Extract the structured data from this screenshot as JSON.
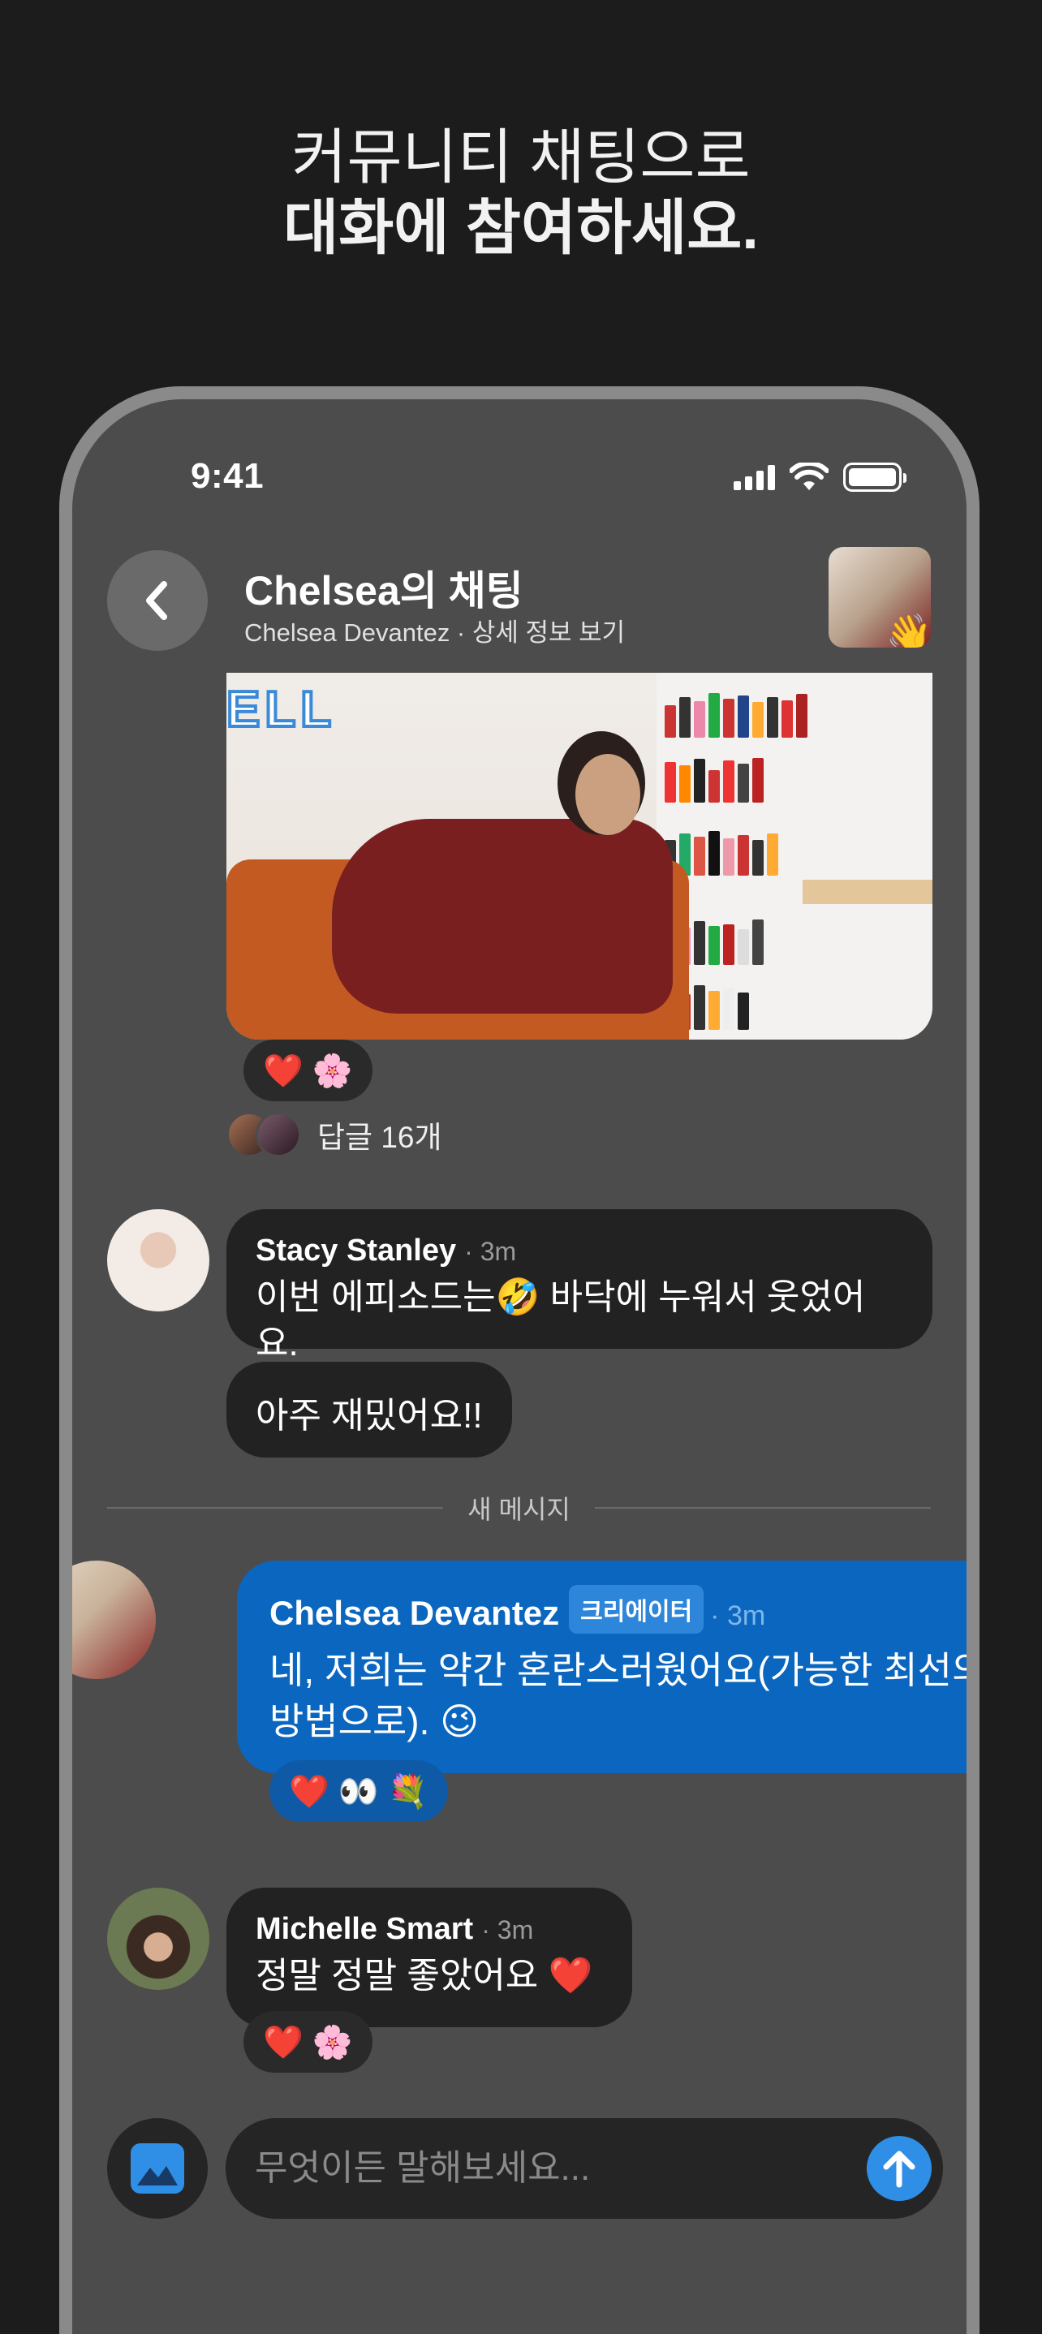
{
  "headline": {
    "line1": "커뮤니티 채팅으로",
    "line2": "대화에 참여하세요."
  },
  "status_bar": {
    "time": "9:41"
  },
  "chat_header": {
    "title": "Chelsea의 채팅",
    "subtitle": "Chelsea Devantez · 상세 정보 보기",
    "thumb_emoji": "👋"
  },
  "post": {
    "logo_text": "ELL",
    "reactions": "❤️ 🌸",
    "replies_label": "답글 16개"
  },
  "messages": [
    {
      "author": "Stacy Stanley",
      "time": "3m",
      "text": "이번 에피소드는🤣 바닥에 누워서 웃었어요."
    },
    {
      "author": "Stacy Stanley",
      "text": "아주 재밌어요!!"
    }
  ],
  "divider_label": "새 메시지",
  "creator_message": {
    "author": "Chelsea Devantez",
    "badge": "크리에이터",
    "time": "3m",
    "text": "네, 저희는 약간 혼란스러웠어요(가능한 최선의 방법으로). 😉",
    "reactions": "❤️ 👀 💐"
  },
  "last_message": {
    "author": "Michelle Smart",
    "time": "3m",
    "text": "정말 정말 좋았어요 ❤️",
    "reactions": "❤️ 🌸"
  },
  "composer": {
    "placeholder": "무엇이든 말해보세요..."
  },
  "colors": {
    "creator_bubble": "#0a66bf",
    "send_button": "#2f8fe6",
    "screen_bg": "#4c4c4c"
  }
}
